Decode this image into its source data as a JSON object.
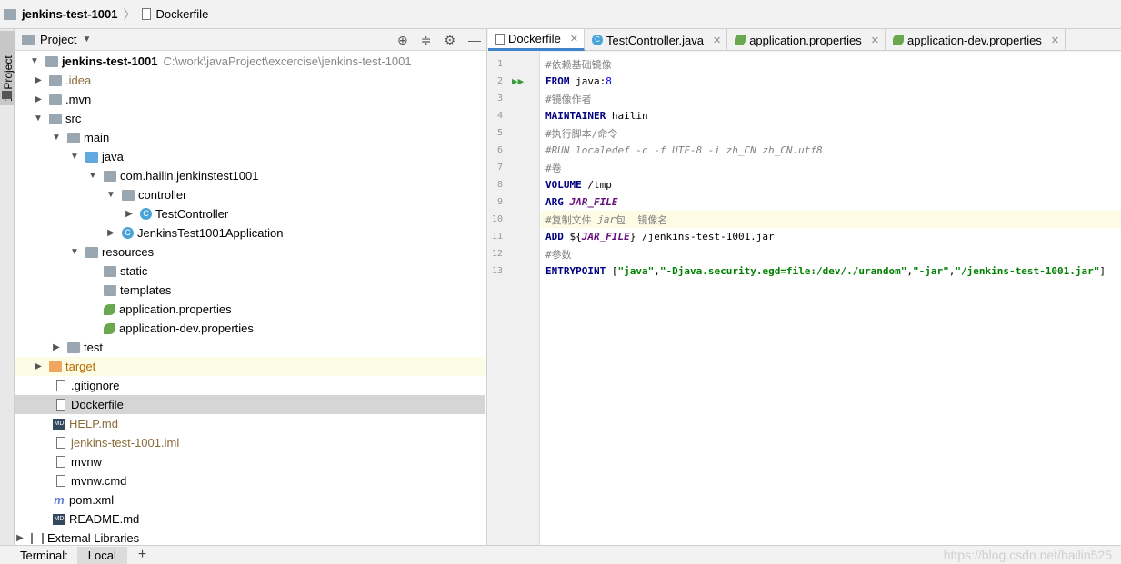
{
  "breadcrumb": {
    "project": "jenkins-test-1001",
    "file": "Dockerfile"
  },
  "side_tab": "1: Project",
  "project_panel": {
    "title": "Project",
    "tree": [
      {
        "label": "jenkins-test-1001",
        "path": "C:\\work\\javaProject\\excercise\\jenkins-test-1001"
      },
      {
        "label": ".idea"
      },
      {
        "label": ".mvn"
      },
      {
        "label": "src"
      },
      {
        "label": "main"
      },
      {
        "label": "java"
      },
      {
        "label": "com.hailin.jenkinstest1001"
      },
      {
        "label": "controller"
      },
      {
        "label": "TestController"
      },
      {
        "label": "JenkinsTest1001Application"
      },
      {
        "label": "resources"
      },
      {
        "label": "static"
      },
      {
        "label": "templates"
      },
      {
        "label": "application.properties"
      },
      {
        "label": "application-dev.properties"
      },
      {
        "label": "test"
      },
      {
        "label": "target"
      },
      {
        "label": ".gitignore"
      },
      {
        "label": "Dockerfile"
      },
      {
        "label": "HELP.md"
      },
      {
        "label": "jenkins-test-1001.iml"
      },
      {
        "label": "mvnw"
      },
      {
        "label": "mvnw.cmd"
      },
      {
        "label": "pom.xml"
      },
      {
        "label": "README.md"
      },
      {
        "label": "External Libraries"
      }
    ]
  },
  "editor_tabs": [
    {
      "label": "Dockerfile"
    },
    {
      "label": "TestController.java"
    },
    {
      "label": "application.properties"
    },
    {
      "label": "application-dev.properties"
    }
  ],
  "code": {
    "line_numbers": [
      "1",
      "2",
      "3",
      "4",
      "5",
      "6",
      "7",
      "8",
      "9",
      "10",
      "11",
      "12",
      "13"
    ],
    "l1": "#依赖基础镜像",
    "l2_kw": "FROM",
    "l2_a": " java",
    "l2_b": ":",
    "l2_c": "8",
    "l3": "#镜像作者",
    "l4_kw": "MAINTAINER",
    "l4_a": " hailin",
    "l5": "#执行脚本/命令",
    "l6": "#RUN localedef -c -f UTF-8 -i zh_CN zh_CN.utf8",
    "l7": "#卷",
    "l8_kw": "VOLUME",
    "l8_a": " /tmp",
    "l9_kw": "ARG",
    "l9_a": " JAR_FILE",
    "l10_a": "#复制文件 ",
    "l10_b": "jar",
    "l10_c": "包  镜像名",
    "l11_kw": "ADD",
    "l11_a": " ${",
    "l11_b": "JAR_FILE",
    "l11_c": "} /jenkins-test-1001.jar",
    "l12": "#参数",
    "l13_kw": "ENTRYPOINT",
    "l13_a": " [",
    "l13_b": "\"java\"",
    "l13_c": ",",
    "l13_d": "\"-Djava.security.egd=file:/dev/./urandom\"",
    "l13_e": ",",
    "l13_f": "\"-jar\"",
    "l13_g": ",",
    "l13_h": "\"/jenkins-test-1001.jar\"",
    "l13_i": "]"
  },
  "bottom_bar": {
    "terminal_label": "Terminal:",
    "local_tab": "Local",
    "add": "+"
  },
  "watermark": "https://blog.csdn.net/hailin525"
}
